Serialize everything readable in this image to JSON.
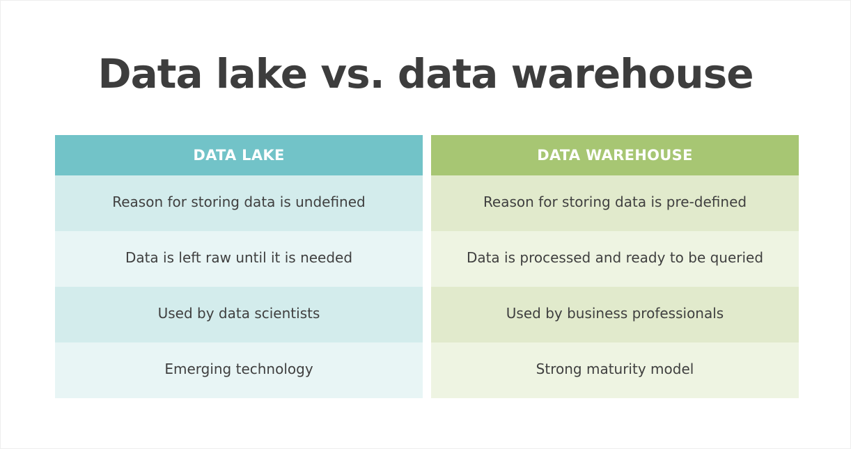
{
  "title": "Data lake vs. data warehouse",
  "colors": {
    "lake_header": "#72c3c8",
    "lake_row_dark": "#d3ecec",
    "lake_row_light": "#e8f5f5",
    "warehouse_header": "#a7c673",
    "warehouse_row_dark": "#e1eacc",
    "warehouse_row_light": "#eef4e2",
    "title_text": "#3d3d3d",
    "body_text": "#3f3f3f"
  },
  "columns": [
    {
      "key": "lake",
      "header": "DATA LAKE",
      "rows": [
        "Reason for storing data is undefined",
        "Data is left raw until it is needed",
        "Used by data scientists",
        "Emerging technology"
      ]
    },
    {
      "key": "warehouse",
      "header": "DATA WAREHOUSE",
      "rows": [
        "Reason for storing data is pre-defined",
        "Data is processed and ready to be queried",
        "Used by business professionals",
        "Strong maturity model"
      ]
    }
  ]
}
